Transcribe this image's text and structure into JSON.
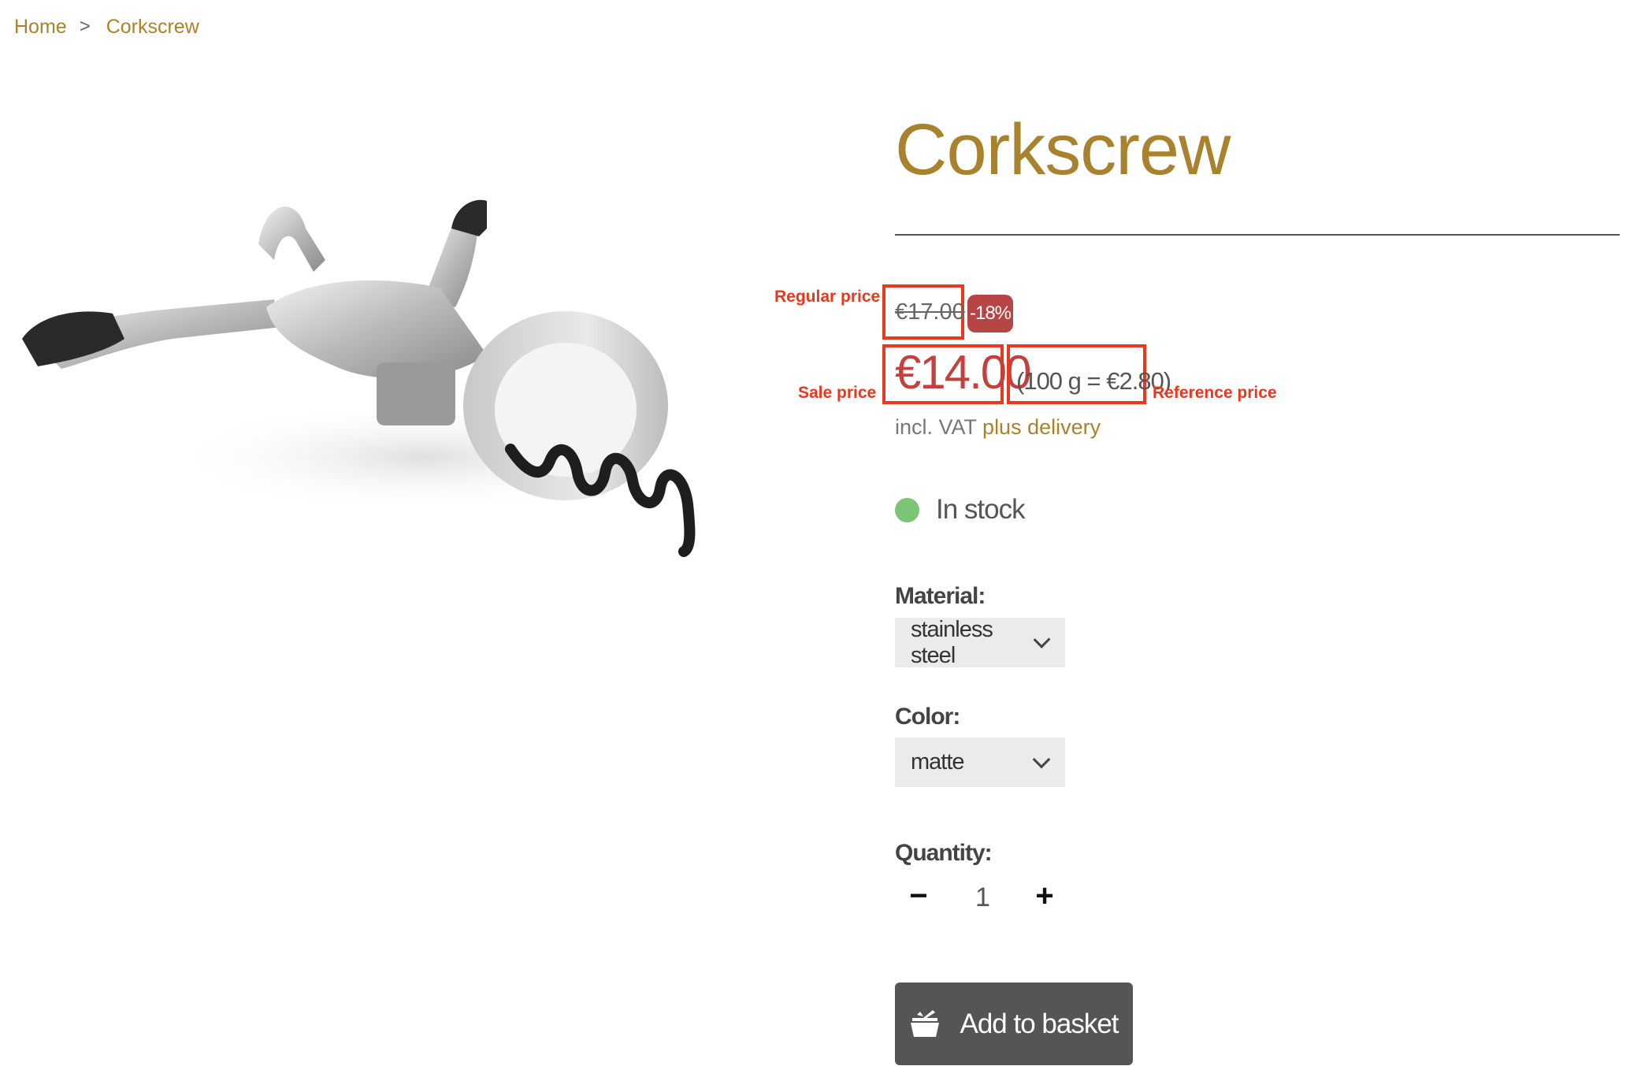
{
  "breadcrumb": {
    "home": "Home",
    "separator": ">",
    "current": "Corkscrew"
  },
  "product": {
    "title": "Corkscrew",
    "image_icon": "corkscrew-photo",
    "regular_price": "€17.00",
    "discount_badge": "-18%",
    "sale_price": "€14.00",
    "reference_price": "(100 g = €2.80)",
    "vat_text": "incl. VAT",
    "delivery_link": "plus delivery",
    "stock_status": "In stock"
  },
  "annotations": {
    "regular_price": "Regular price",
    "sale_price": "Sale price",
    "reference_price": "Reference price"
  },
  "options": {
    "material_label": "Material:",
    "material_value": "stainless steel",
    "color_label": "Color:",
    "color_value": "matte"
  },
  "quantity": {
    "label": "Quantity:",
    "minus": "−",
    "value": "1",
    "plus": "+"
  },
  "cart": {
    "add_button": "Add to basket",
    "icon": "basket-icon"
  },
  "colors": {
    "accent_gold": "#a8822c",
    "sale_red": "#c4403d",
    "badge_red": "#b84545",
    "annotation_red": "#e8391d",
    "stock_green": "#7cc576",
    "button_gray": "#555555"
  }
}
